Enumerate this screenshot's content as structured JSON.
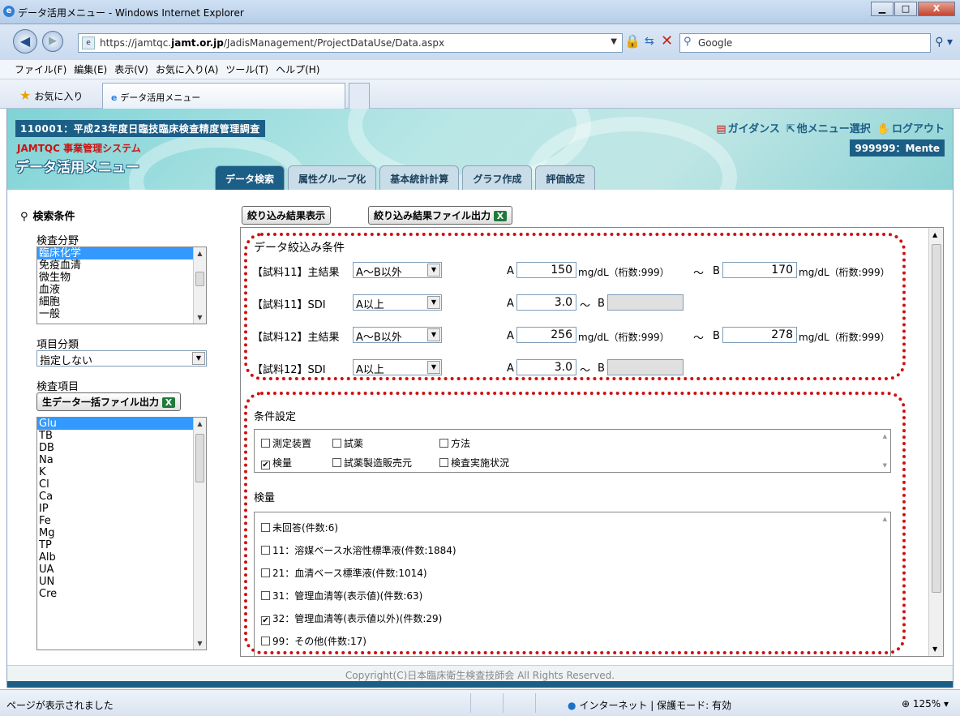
{
  "window": {
    "title": "データ活用メニュー - Windows Internet Explorer",
    "min": "▁",
    "max": "□",
    "close": "X"
  },
  "address": {
    "prefix": "https://jamtqc.",
    "domain": "jamt.or.jp",
    "path": "/JadisManagement/ProjectDataUse/Data.aspx"
  },
  "search": {
    "placeholder": "Google"
  },
  "menubar": [
    "ファイル(F)",
    "編集(E)",
    "表示(V)",
    "お気に入り(A)",
    "ツール(T)",
    "ヘルプ(H)"
  ],
  "favorites": {
    "label": "お気に入り",
    "tab": "データ活用メニュー"
  },
  "header": {
    "survey": "110001：平成23年度日臨技臨床検査精度管理調査",
    "system_en": "JAMTQC",
    "system_jp": "事業管理システム",
    "title": "データ活用メニュー",
    "links": [
      "ガイダンス",
      "他メニュー選択",
      "ログアウト"
    ],
    "user": "999999：Mente",
    "tabs": [
      "データ検索",
      "属性グループ化",
      "基本統計計算",
      "グラフ作成",
      "評価設定"
    ]
  },
  "left": {
    "section_title": "検索条件",
    "field_label": "検査分野",
    "fields": [
      "臨床化学",
      "免疫血清",
      "微生物",
      "血液",
      "細胞",
      "一般"
    ],
    "category_label": "項目分類",
    "category_value": "指定しない",
    "items_label": "検査項目",
    "export_label": "生データ一括ファイル出力",
    "items": [
      "Glu",
      "TB",
      "DB",
      "Na",
      "K",
      "Cl",
      "Ca",
      "IP",
      "Fe",
      "Mg",
      "TP",
      "Alb",
      "UA",
      "UN",
      "Cre"
    ]
  },
  "buttons": {
    "show": "絞り込み結果表示",
    "export": "絞り込み結果ファイル出力",
    "x": "X"
  },
  "conditions": {
    "title": "データ絞込み条件",
    "rows": [
      {
        "label": "【試料11】主結果",
        "op": "A～B以外",
        "a_label": "A",
        "a": "150",
        "unit1": "mg/dL（桁数:999）",
        "tilde": "～",
        "b_label": "B",
        "b": "170",
        "unit2": "mg/dL（桁数:999）"
      },
      {
        "label": "【試料11】SDI",
        "op": "A以上",
        "a_label": "A",
        "a": "3.0",
        "tilde": "～",
        "b_label": "B",
        "b": ""
      },
      {
        "label": "【試料12】主結果",
        "op": "A～B以外",
        "a_label": "A",
        "a": "256",
        "unit1": "mg/dL（桁数:999）",
        "tilde": "～",
        "b_label": "B",
        "b": "278",
        "unit2": "mg/dL（桁数:999）"
      },
      {
        "label": "【試料12】SDI",
        "op": "A以上",
        "a_label": "A",
        "a": "3.0",
        "tilde": "～",
        "b_label": "B",
        "b": ""
      }
    ]
  },
  "settings": {
    "title": "条件設定",
    "options": [
      {
        "label": "測定装置",
        "checked": false
      },
      {
        "label": "試薬",
        "checked": false
      },
      {
        "label": "方法",
        "checked": false
      },
      {
        "label": "検量",
        "checked": true
      },
      {
        "label": "試薬製造販売元",
        "checked": false
      },
      {
        "label": "検査実施状況",
        "checked": false
      }
    ]
  },
  "calibration": {
    "title": "検量",
    "items": [
      {
        "label": "未回答(件数:6)",
        "checked": false
      },
      {
        "label": "11：溶媒ベース水溶性標準液(件数:1884)",
        "checked": false
      },
      {
        "label": "21：血清ベース標準液(件数:1014)",
        "checked": false
      },
      {
        "label": "31：管理血清等(表示値)(件数:63)",
        "checked": false
      },
      {
        "label": "32：管理血清等(表示値以外)(件数:29)",
        "checked": true
      },
      {
        "label": "99：その他(件数:17)",
        "checked": false
      }
    ]
  },
  "footer": {
    "copyright": "Copyright(C)日本臨床衛生検査技師会 All Rights Reserved."
  },
  "status": {
    "text": "ページが表示されました",
    "zone": "インターネット | 保護モード: 有効",
    "zoom": "125%"
  },
  "colors": {
    "accent": "#1b5e86",
    "highlight": "#d01010",
    "selection": "#3399ff"
  }
}
